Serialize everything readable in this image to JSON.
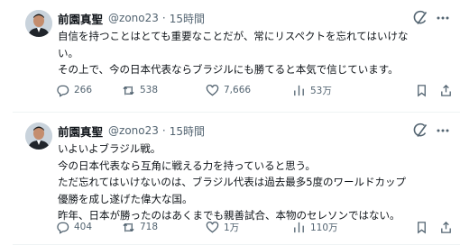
{
  "posts": [
    {
      "author": {
        "name": "前園真聖",
        "handle": "@zono23",
        "time": "15時間"
      },
      "body": [
        "自信を持つことはとても重要なことだが、常にリスペクトを忘れてはいけな",
        "い。",
        "その上で、今の日本代表ならブラジルにも勝てると本気で信じています。"
      ],
      "stats": {
        "replies": "266",
        "reposts": "538",
        "likes": "7,666",
        "views": "53万"
      }
    },
    {
      "author": {
        "name": "前園真聖",
        "handle": "@zono23",
        "time": "15時間"
      },
      "body": [
        "いよいよブラジル戦。",
        "今の日本代表なら互角に戦える力を持っていると思う。",
        "ただ忘れてはいけないのは、ブラジル代表は過去最多5度のワールドカップ",
        "優勝を成し遂げた偉大な国。",
        "昨年、日本が勝ったのはあくまでも親善試合、本物のセレソンではない。"
      ],
      "stats": {
        "replies": "404",
        "reposts": "718",
        "likes": "1万",
        "views": "110万"
      }
    }
  ],
  "icons": {
    "grok": "grok-icon",
    "more": "more-options-icon",
    "reply": "reply-icon",
    "repost": "repost-icon",
    "like": "like-icon",
    "views": "views-icon",
    "bookmark": "bookmark-icon",
    "share": "share-icon"
  },
  "colors": {
    "text": "#0f1419",
    "secondary": "#536471",
    "divider": "#eff3f4"
  }
}
